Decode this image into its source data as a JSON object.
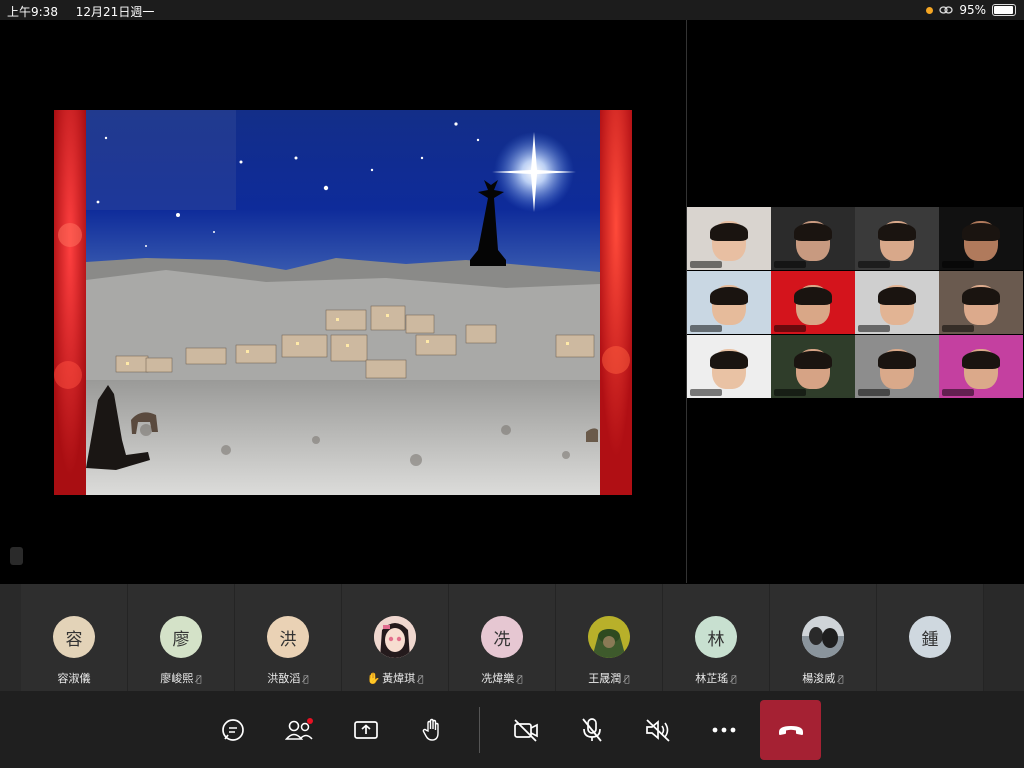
{
  "status_bar": {
    "time": "上午9:38",
    "date": "12月21日週一",
    "battery": "95%",
    "battery_level": 0.95,
    "recording_dot_color": "#f5a623"
  },
  "shared_screen": {
    "content_icon": "nativity-christmas-slide-image",
    "frame_color": "#c9151a"
  },
  "gallery": {
    "tiles": [
      {
        "bg": "#d9d4cf",
        "face": "#e8bfa2",
        "accent": "#c0202a"
      },
      {
        "bg": "#2b2b2b",
        "face": "#c89a80",
        "accent": "#3b2f2a"
      },
      {
        "bg": "#3a3a3a",
        "face": "#d8a88a",
        "accent": "#222"
      },
      {
        "bg": "#111111",
        "face": "#b07a5c",
        "accent": "#c0705a"
      },
      {
        "bg": "#c9d7e3",
        "face": "#e6bb9b",
        "accent": "#4a5a6a"
      },
      {
        "bg": "#d4141c",
        "face": "#d9a787",
        "accent": "#d4141c"
      },
      {
        "bg": "#cfcfcf",
        "face": "#e2b494",
        "accent": "#556"
      },
      {
        "bg": "#6a5a4f",
        "face": "#dcaa8c",
        "accent": "#3b3b3b"
      },
      {
        "bg": "#eeeeee",
        "face": "#e9c2a4",
        "accent": "#2a3a55"
      },
      {
        "bg": "#2f3d2a",
        "face": "#d6a385",
        "accent": "#bcc"
      },
      {
        "bg": "#8d8d8d",
        "face": "#d9a98a",
        "accent": "#444"
      },
      {
        "bg": "#c440a0",
        "face": "#dba98a",
        "accent": "#222"
      },
      {
        "bg": "#e6e3df",
        "face": "#e8bd9d",
        "accent": "#333"
      },
      {
        "bg": "#b9c8d4",
        "face": "#d7a689",
        "accent": "#fff"
      },
      {
        "bg": "#7a6f66",
        "face": "#dcae91",
        "accent": "#2a2a2a"
      },
      {
        "bg": "#5a1a1a",
        "face": "#e3b395",
        "accent": "#c23"
      }
    ]
  },
  "participants": [
    {
      "initial": "容",
      "name": "容淑儀",
      "avatar_color": "#e3d3b8",
      "muted": false,
      "hand": false
    },
    {
      "initial": "廖",
      "name": "廖峻熙",
      "avatar_color": "#d4e2c8",
      "muted": true,
      "hand": false
    },
    {
      "initial": "洪",
      "name": "洪敔滔",
      "avatar_color": "#ead2b5",
      "muted": true,
      "hand": false
    },
    {
      "initial": "",
      "name": "黃煒琪",
      "avatar_color": "#e9c9c0",
      "muted": true,
      "hand": true,
      "avatar_icon": "anime-girl-avatar-icon"
    },
    {
      "initial": "冼",
      "name": "冼煒樂",
      "avatar_color": "#e6c7d2",
      "muted": true,
      "hand": false
    },
    {
      "initial": "",
      "name": "王晟潤",
      "avatar_color": "#4c6b3a",
      "muted": true,
      "hand": false,
      "avatar_icon": "soldier-avatar-icon"
    },
    {
      "initial": "林",
      "name": "林芷瑤",
      "avatar_color": "#c8e0d0",
      "muted": true,
      "hand": false
    },
    {
      "initial": "",
      "name": "楊浚威",
      "avatar_color": "#9aa3ab",
      "muted": true,
      "hand": false,
      "avatar_icon": "photo-avatar-icon"
    },
    {
      "initial": "鍾",
      "name": "",
      "avatar_color": "#cfd8df",
      "muted": false,
      "hand": false
    }
  ],
  "hand_glyph": "✋",
  "mute_glyph": "🎙̸",
  "toolbar": {
    "buttons": [
      {
        "icon": "chat-icon"
      },
      {
        "icon": "participants-icon",
        "badge_color": "#e81123"
      },
      {
        "icon": "share-screen-icon"
      },
      {
        "icon": "raise-hand-icon"
      },
      {
        "icon": "camera-off-icon"
      },
      {
        "icon": "mic-off-icon"
      },
      {
        "icon": "speaker-off-icon"
      },
      {
        "icon": "more-options-icon"
      },
      {
        "icon": "hang-up-icon"
      }
    ],
    "hangup_color": "#a52133"
  }
}
